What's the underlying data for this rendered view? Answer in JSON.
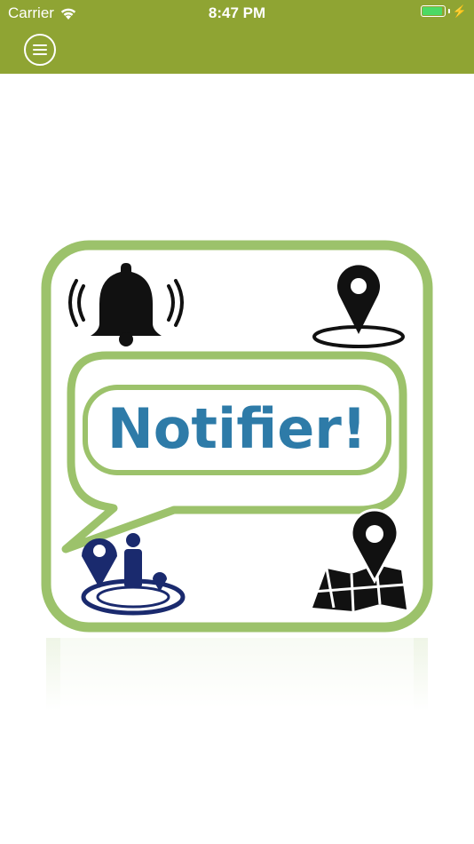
{
  "status_bar": {
    "carrier": "Carrier",
    "time": "8:47 PM",
    "battery_level": 1.0,
    "battery_color": "#4cd964"
  },
  "nav_bar": {
    "background_color": "#8fa433",
    "menu_icon": "hamburger-menu-icon"
  },
  "app_logo": {
    "text": "Notifier!",
    "text_color": "#2e7ba8",
    "frame_color": "#9cc26b",
    "icons": [
      "bell-ringing-icon",
      "location-pin-icon",
      "person-location-icon",
      "map-pin-icon"
    ]
  }
}
